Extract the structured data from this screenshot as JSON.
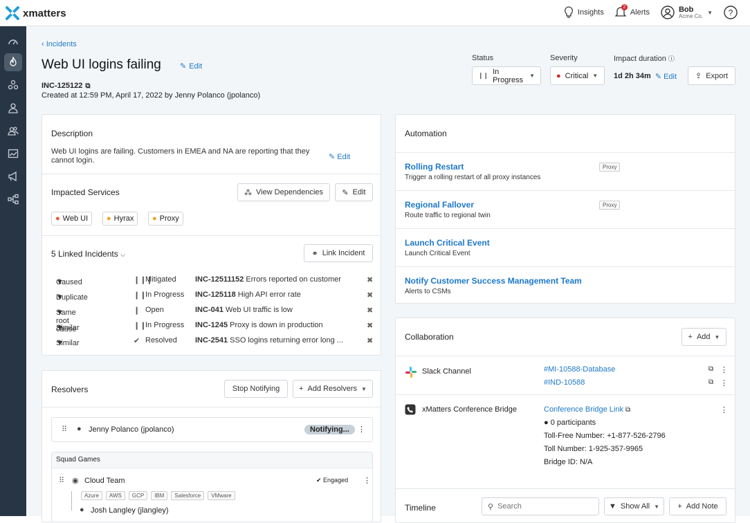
{
  "app": {
    "brand": "xmatters"
  },
  "topnav": {
    "insights": "Insights",
    "alerts": "Alerts",
    "alerts_badge": "2",
    "user_name": "Bob",
    "user_org": "Acme Co."
  },
  "breadcrumb": "Incidents",
  "incident": {
    "title": "Web UI logins failing",
    "edit": "Edit",
    "id": "INC-125122",
    "created": "Created at 12:59 PM, April 17, 2022 by Jenny Polanco (jpolanco)"
  },
  "header": {
    "status_label": "Status",
    "status_value": "In Progress",
    "severity_label": "Severity",
    "severity_value": "Critical",
    "impact_label": "Impact duration",
    "impact_value": "1d 2h 34m",
    "impact_edit": "Edit",
    "export": "Export"
  },
  "description": {
    "title": "Description",
    "text": "Web UI logins are failing. Customers in EMEA and NA are reporting that they cannot login.",
    "edit": "Edit"
  },
  "impacted": {
    "title": "Impacted Services",
    "view_deps": "View Dependencies",
    "edit": "Edit",
    "services": [
      "Web UI",
      "Hyrax",
      "Proxy"
    ]
  },
  "linked": {
    "title": "5 Linked Incidents",
    "link_btn": "Link Incident",
    "rows": [
      {
        "rel": "Caused",
        "status": "Mitigated",
        "id": "INC-12511152",
        "desc": "Errors reported on customer"
      },
      {
        "rel": "Duplicate",
        "status": "In Progress",
        "id": "INC-125118",
        "desc": "High API error rate"
      },
      {
        "rel": "Same root cause",
        "status": "Open",
        "id": "INC-041",
        "desc": "Web UI traffic is low"
      },
      {
        "rel": "Similar",
        "status": "In Progress",
        "id": "INC-1245",
        "desc": "Proxy is down in production"
      },
      {
        "rel": "Similar",
        "status": "Resolved",
        "id": "INC-2541",
        "desc": "SSO logins returning error long ..."
      }
    ]
  },
  "resolvers": {
    "title": "Resolvers",
    "stop": "Stop Notifying",
    "add": "Add Resolvers",
    "person": "Jenny Polanco (jpolanco)",
    "person_status": "Notifying...",
    "group": "Squad Games",
    "team": "Cloud Team",
    "team_status": "Engaged",
    "tags": [
      "Azure",
      "AWS",
      "GCP",
      "IBM",
      "Salesforce",
      "VMware"
    ],
    "member": "Josh Langley (jlangley)"
  },
  "automation": {
    "title": "Automation",
    "items": [
      {
        "title": "Rolling Restart",
        "sub": "Trigger a rolling restart of all proxy instances",
        "tag": "Proxy"
      },
      {
        "title": "Regional Fallover",
        "sub": "Route traffic to regional twin",
        "tag": "Proxy"
      },
      {
        "title": "Launch Critical Event",
        "sub": "Launch Critical Event",
        "tag": ""
      },
      {
        "title": "Notify Customer Success Management Team",
        "sub": "Alerts to CSMs",
        "tag": ""
      }
    ]
  },
  "collab": {
    "title": "Collaboration",
    "add": "Add",
    "slack_label": "Slack Channel",
    "slack_links": [
      "#MI-10588-Database",
      "#IND-10588"
    ],
    "bridge_label": "xMatters Conference Bridge",
    "bridge_link": "Conference Bridge Link",
    "participants": "0 participants",
    "tollfree": "Toll-Free Number: +1-877-526-2796",
    "toll": "Toll Number: 1-925-357-9965",
    "bridge_id": "Bridge ID: N/A"
  },
  "timeline": {
    "title": "Timeline",
    "search_placeholder": "Search",
    "show_all": "Show All",
    "add_note": "Add Note"
  },
  "colors": {
    "accent": "#1e78c8",
    "sidebar": "#283544",
    "critical": "#d6262b",
    "service": "#f0a020"
  }
}
